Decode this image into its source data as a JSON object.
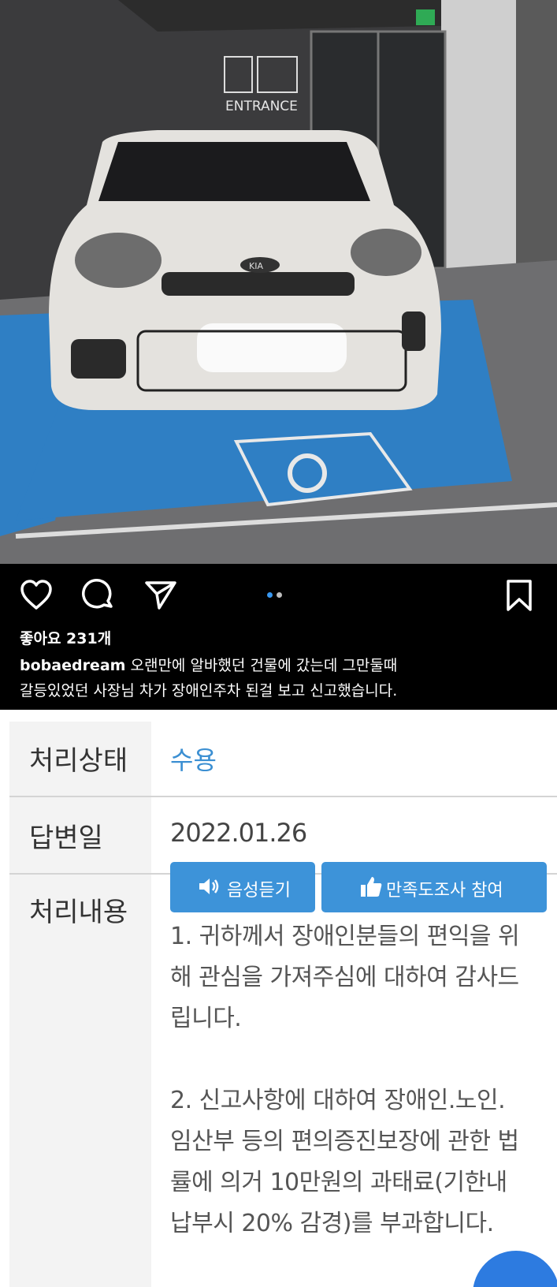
{
  "post": {
    "photo_sign_text": "ENTRANCE",
    "photo_brand_badge": "KIA",
    "likes_text": "좋아요 231개",
    "username": "bobaedream",
    "caption_line1": " 오랜만에 알바했던 건물에 갔는데 그만둘때",
    "caption_line2": "갈등있었던 사장님 차가 장애인주차 된걸 보고 신고했습니다.",
    "carousel_dots": {
      "count": 2,
      "active_index": 0
    },
    "icons": [
      "heart-icon",
      "comment-icon",
      "share-icon",
      "bookmark-icon"
    ]
  },
  "complaint": {
    "status_label": "처리상태",
    "status_value": "수용",
    "answer_date_label": "답변일",
    "answer_date_value": "2022.01.26",
    "details_label": "처리내용",
    "voice_button": "음성듣기",
    "survey_button": "만족도조사 참여",
    "content_lines": [
      "1. 귀하께서 장애인분들의 편익을 위",
      "해 관심을 가져주심에 대하여 감사드",
      "립니다.",
      "",
      "2. 신고사항에 대하여 장애인.노인.",
      "임산부 등의 편의증진보장에 관한 법",
      "률에 의거 10만원의 과태료(기한내",
      "납부시 20% 감경)를 부과합니다."
    ]
  },
  "colors": {
    "accent_blue": "#3d93d9",
    "status_blue": "#3b8fd2",
    "label_bg": "#f3f3f3",
    "dot_active": "#3897f0"
  }
}
